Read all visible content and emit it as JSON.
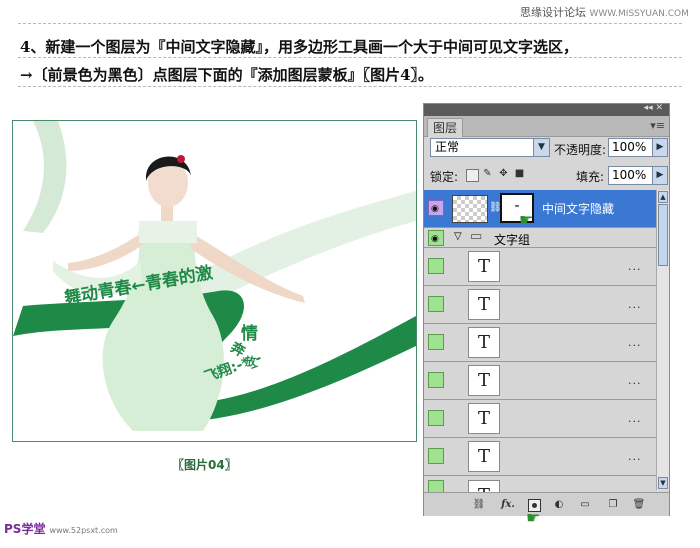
{
  "header": {
    "site_name": "思缘设计论坛",
    "site_url": "WWW.MISSYUAN.COM",
    "instruction_line1": "4、新建一个图层为『中间文字隐藏』，用多边形工具画一个大于中间可见文字选区，",
    "instruction_line2": "→〔前景色为黑色〕点图层下面的『添加图层蒙板』〖图片4〗。"
  },
  "figure": {
    "caption": "〖图片04〗",
    "artwork_text_1": "舞动青春←青春的激",
    "artwork_text_2": "情",
    "artwork_text_3": "奔",
    "artwork_text_4": "放",
    "artwork_text_5": "飞翔:-*_-",
    "colors": {
      "ribbon_dark": "#1f8a47",
      "ribbon_light": "#cfe8d3",
      "dress": "#d6edd6"
    }
  },
  "footer": {
    "logo_text": "PS学堂",
    "logo_url": "www.52psxt.com"
  },
  "layers_panel": {
    "tab_label": "图层",
    "menu_glyph": "▾≡",
    "collapse_glyph": "◂◂ ✕",
    "blend_mode": "正常",
    "opacity_label": "不透明度:",
    "opacity_value": "100%",
    "lock_label": "锁定:",
    "fill_label": "填充:",
    "fill_value": "100%",
    "selected_layer": {
      "name": "中间文字隐藏",
      "mask_glyph": "-"
    },
    "group": {
      "name": "文字组",
      "collapse_glyph": "▽",
      "folder_glyph": "▭"
    },
    "text_layers": [
      {
        "thumb": "T",
        "dots": "..."
      },
      {
        "thumb": "T",
        "dots": "..."
      },
      {
        "thumb": "T",
        "dots": "..."
      },
      {
        "thumb": "T",
        "dots": "..."
      },
      {
        "thumb": "T",
        "dots": "..."
      },
      {
        "thumb": "T",
        "dots": "..."
      },
      {
        "thumb": "T",
        "dots": ""
      }
    ],
    "bottom_icons": [
      "link-layers-icon",
      "fx-icon",
      "add-mask-icon",
      "adjustment-icon",
      "group-icon",
      "new-layer-icon",
      "trash-icon"
    ],
    "fx_label": "fx.",
    "colors": {
      "selected": "#3a78d4",
      "eye_bg": "#9fe28f",
      "selected_eye_bg": "#c6a6ea"
    }
  }
}
